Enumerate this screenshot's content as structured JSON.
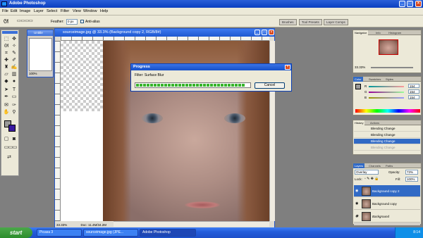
{
  "app": {
    "title": "Adobe Photoshop"
  },
  "menu": [
    "File",
    "Edit",
    "Image",
    "Layer",
    "Select",
    "Filter",
    "View",
    "Window",
    "Help"
  ],
  "options": {
    "feather_label": "Feather:",
    "feather_value": "0 px",
    "antialias_label": "Anti-alias"
  },
  "palette_well": [
    "Brushes",
    "Tool Presets",
    "Layer Comps"
  ],
  "small_doc": {
    "title": "Untitle",
    "zoom": "100%"
  },
  "document": {
    "title": "sourceimage.jpg @ 33.3% (Background copy 2, RGB/8#)",
    "zoom": "33.33%",
    "doc_info": "Doc: 11.4M/34.2M"
  },
  "progress": {
    "title": "Progress",
    "message": "Filter: Surface Blur",
    "cancel": "Cancel",
    "value": 0.96
  },
  "navigator": {
    "tabs": [
      "Navigator",
      "Info",
      "Histogram"
    ],
    "zoom": "33.33%"
  },
  "color": {
    "tabs": [
      "Color",
      "Swatches",
      "Styles"
    ],
    "channels": [
      {
        "label": "R",
        "value": "154"
      },
      {
        "label": "G",
        "value": "154"
      },
      {
        "label": "B",
        "value": "154"
      }
    ]
  },
  "history": {
    "tabs": [
      "History",
      "Actions"
    ],
    "items": [
      "Blending Change",
      "Blending Change",
      "Blending Change",
      "Blending Change"
    ],
    "selected": 2
  },
  "layers": {
    "tabs": [
      "Layers",
      "Channels",
      "Paths"
    ],
    "blend_mode": "Overlay",
    "opacity_label": "Opacity:",
    "opacity": "73%",
    "lock_label": "Lock:",
    "fill_label": "Fill:",
    "fill": "100%",
    "items": [
      "Background copy 2",
      "Background copy",
      "Background"
    ],
    "selected": 0
  },
  "taskbar": {
    "start": "start",
    "tasks": [
      "Picasa 3",
      "sourceimage.jpg (JPE...",
      "Adobe Photoshop"
    ],
    "active": 2,
    "time": "8:14"
  },
  "colors": {
    "title_blue": "#0a3ec0",
    "selection_blue": "#316ac5",
    "progress_green": "#37b42b",
    "start_green": "#2c8d2c"
  }
}
